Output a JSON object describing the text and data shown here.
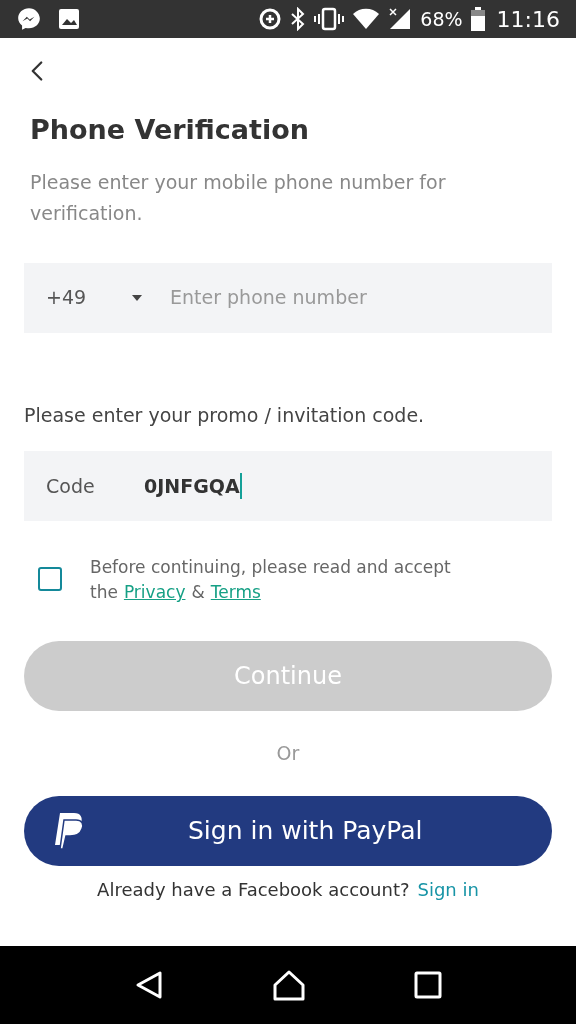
{
  "status_bar": {
    "battery": "68%",
    "time": "11:16"
  },
  "title": "Phone Verification",
  "subtitle": "Please enter your mobile phone number for verification.",
  "phone": {
    "country_code": "+49",
    "placeholder": "Enter phone number"
  },
  "promo_label": "Please enter your promo / invitation code.",
  "code": {
    "label": "Code",
    "value": "0JNFGQA",
    "focused": true
  },
  "terms": {
    "checked": false,
    "line1": "Before continuing, please read and accept",
    "the": "the",
    "privacy": "Privacy",
    "and": "&",
    "terms": "Terms"
  },
  "continue": {
    "label": "Continue",
    "disabled": true
  },
  "or": "Or",
  "paypal": {
    "label": "Sign in with PayPal"
  },
  "overlay": {
    "text": "Already have a Facebook account?",
    "link": "Sign in"
  }
}
